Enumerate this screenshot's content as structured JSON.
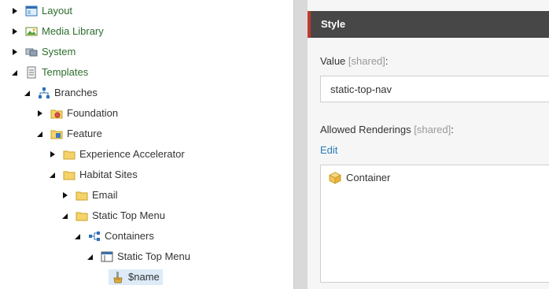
{
  "tree": {
    "items": [
      {
        "label": "Layout"
      },
      {
        "label": "Media Library"
      },
      {
        "label": "System"
      },
      {
        "label": "Templates"
      },
      {
        "label": "Branches"
      },
      {
        "label": "Foundation"
      },
      {
        "label": "Feature"
      },
      {
        "label": "Experience Accelerator"
      },
      {
        "label": "Habitat Sites"
      },
      {
        "label": "Email"
      },
      {
        "label": "Static Top Menu"
      },
      {
        "label": "Containers"
      },
      {
        "label": "Static Top Menu"
      },
      {
        "label": "$name"
      }
    ]
  },
  "editor": {
    "section_title": "Style",
    "value_field": {
      "label": "Value",
      "shared_tag": "[shared]",
      "colon": ":",
      "value": "static-top-nav"
    },
    "allowed_renderings": {
      "label": "Allowed Renderings",
      "shared_tag": "[shared]",
      "colon": ":",
      "edit_link": "Edit",
      "items": [
        {
          "label": "Container"
        }
      ]
    }
  },
  "colors": {
    "section_header_bg": "#474747",
    "section_accent": "#c0392b",
    "link": "#2a7ab8",
    "tree_green_text": "#2c6e2c",
    "selection": "#dcebf7"
  },
  "icons": [
    "layout-icon",
    "media-library-icon",
    "system-icon",
    "templates-icon",
    "branches-icon",
    "foundation-folder-icon",
    "feature-folder-icon",
    "folder-icon",
    "containers-icon",
    "static-top-menu-icon",
    "branch-template-icon",
    "rendering-icon"
  ]
}
